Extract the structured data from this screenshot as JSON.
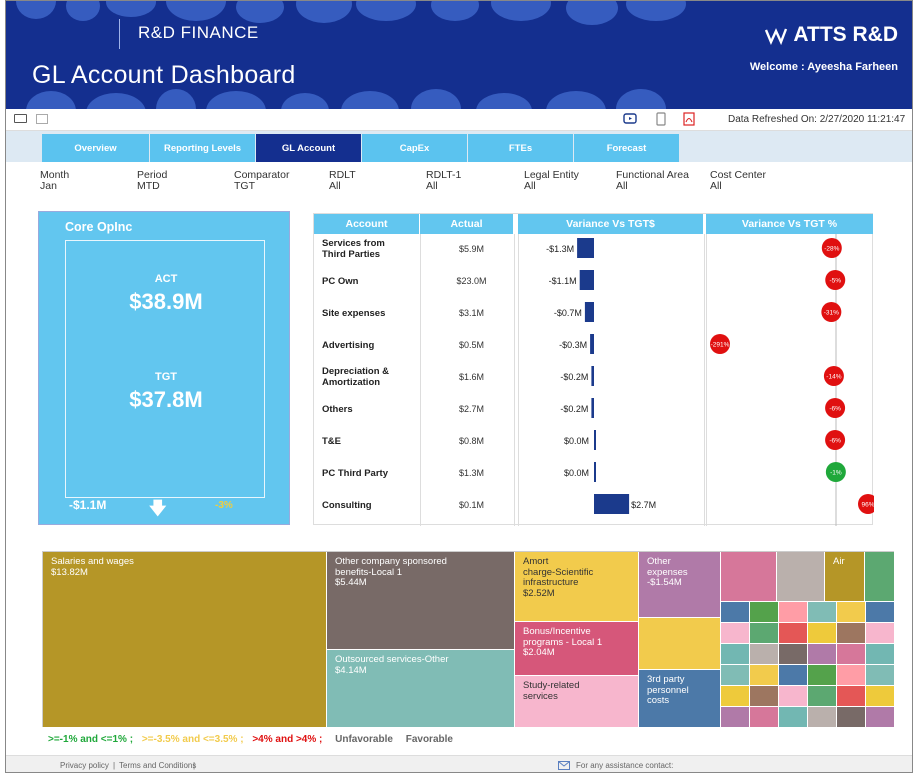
{
  "header": {
    "brand": "R&D FINANCE",
    "title": "GL Account Dashboard",
    "logo": "ATTS R&D",
    "welcome": "Welcome : Ayeesha Farheen"
  },
  "toolbar": {
    "refreshed": "Data Refreshed On: 2/27/2020 11:21:47"
  },
  "tabs": [
    "Overview",
    "Reporting Levels",
    "GL Account",
    "CapEx",
    "FTEs",
    "Forecast"
  ],
  "filters": [
    {
      "label": "Month",
      "value": "Jan"
    },
    {
      "label": "Period",
      "value": "MTD"
    },
    {
      "label": "Comparator",
      "value": "TGT"
    },
    {
      "label": "RDLT",
      "value": "All"
    },
    {
      "label": "RDLT-1",
      "value": "All"
    },
    {
      "label": "Legal Entity",
      "value": "All"
    },
    {
      "label": "Functional Area",
      "value": "All"
    },
    {
      "label": "Cost Center",
      "value": "All"
    }
  ],
  "core": {
    "title": "Core OpInc",
    "act_label": "ACT",
    "act_value": "$38.9M",
    "tgt_label": "TGT",
    "tgt_value": "$37.8M",
    "variance": "-$1.1M",
    "variance_pct": "-3%"
  },
  "table": {
    "headers": [
      "Account",
      "Actual",
      "Variance Vs TGT$",
      "Variance Vs TGT %"
    ],
    "rows": [
      {
        "account": "Services from\nThird Parties",
        "actual": "$5.9M",
        "var": "-$1.3M",
        "var_num": -1.3,
        "pct": "-28%",
        "pct_num": -28,
        "pct_color": "#e01010"
      },
      {
        "account": "PC Own",
        "actual": "$23.0M",
        "var": "-$1.1M",
        "var_num": -1.1,
        "pct": "-5%",
        "pct_num": -5,
        "pct_color": "#e01010"
      },
      {
        "account": "Site expenses",
        "actual": "$3.1M",
        "var": "-$0.7M",
        "var_num": -0.7,
        "pct": "-31%",
        "pct_num": -31,
        "pct_color": "#e01010"
      },
      {
        "account": "Advertising",
        "actual": "$0.5M",
        "var": "-$0.3M",
        "var_num": -0.3,
        "pct": "-291%",
        "pct_num": -291,
        "pct_color": "#e01010"
      },
      {
        "account": "Depreciation &\nAmortization",
        "actual": "$1.6M",
        "var": "-$0.2M",
        "var_num": -0.2,
        "pct": "-14%",
        "pct_num": -14,
        "pct_color": "#e01010"
      },
      {
        "account": "Others",
        "actual": "$2.7M",
        "var": "-$0.2M",
        "var_num": -0.2,
        "pct": "-6%",
        "pct_num": -6,
        "pct_color": "#e01010"
      },
      {
        "account": "T&E",
        "actual": "$0.8M",
        "var": "$0.0M",
        "var_num": 0.0,
        "pct": "-6%",
        "pct_num": -6,
        "pct_color": "#e01010"
      },
      {
        "account": "PC Third Party",
        "actual": "$1.3M",
        "var": "$0.0M",
        "var_num": 0.0,
        "pct": "-1%",
        "pct_num": -1,
        "pct_color": "#1fa83a"
      },
      {
        "account": "Consulting",
        "actual": "$0.1M",
        "var": "$2.7M",
        "var_num": 2.7,
        "pct": "96%",
        "pct_num": 96,
        "pct_color": "#e01010"
      }
    ]
  },
  "treemap": [
    {
      "label": "Salaries and wages\n$13.82M",
      "color": "#b59627"
    },
    {
      "label": "Other company sponsored\nbenefits-Local 1\n$5.44M",
      "color": "#786a67"
    },
    {
      "label": "Outsourced services-Other\n$4.14M",
      "color": "#80bcb5"
    },
    {
      "label": "Amort\ncharge-Scientific\ninfrastructure\n$2.52M",
      "color": "#f2cb4c"
    },
    {
      "label": "Bonus/Incentive\nprograms - Local 1\n$2.04M",
      "color": "#d6577a"
    },
    {
      "label": "Study-related\nservices",
      "color": "#f7b6cd"
    },
    {
      "label": "Other\nexpenses\n-$1.54M",
      "color": "#b07aa8"
    },
    {
      "label": "",
      "color": "#f2cb4c"
    },
    {
      "label": "3rd party\npersonnel\ncosts",
      "color": "#4c79a8"
    },
    {
      "label": "",
      "color": "#d6779a"
    },
    {
      "label": "",
      "color": "#bab0ac"
    },
    {
      "label": "Air",
      "color": "#b59627"
    },
    {
      "label": "",
      "color": "#5ca871"
    }
  ],
  "legend": [
    {
      "text": ">=-1% and <=1% ;",
      "color": "#1fa83a"
    },
    {
      "text": ">=-3.5% and <=3.5% ;",
      "color": "#f2cb4c"
    },
    {
      "text": ">4% and >4% ;",
      "color": "#e01010"
    },
    {
      "text": "Unfavorable",
      "color": "#666"
    },
    {
      "text": "Favorable",
      "color": "#666"
    }
  ],
  "footer": {
    "privacy": "Privacy policy",
    "terms": "Terms and Conditions",
    "assist": "For any assistance contact:"
  }
}
